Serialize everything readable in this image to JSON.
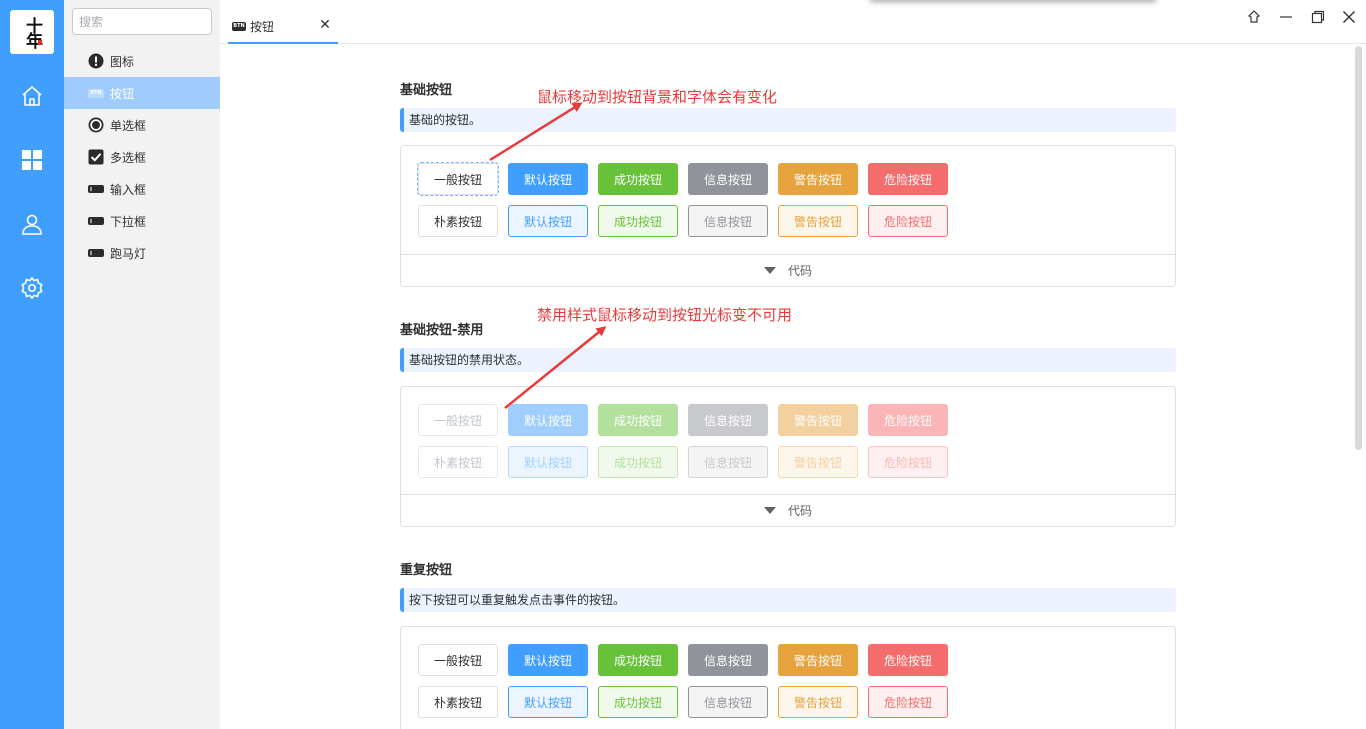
{
  "rail": {
    "logo_text": "十年",
    "items": [
      {
        "name": "home-icon"
      },
      {
        "name": "apps-grid-icon"
      },
      {
        "name": "user-icon"
      },
      {
        "name": "gear-icon"
      }
    ]
  },
  "sidebar": {
    "search_placeholder": "搜索",
    "items": [
      {
        "label": "图标",
        "icon": "alert-circle-icon"
      },
      {
        "label": "按钮",
        "icon": "btn-chip-icon",
        "active": true
      },
      {
        "label": "单选框",
        "icon": "radio-icon"
      },
      {
        "label": "多选框",
        "icon": "checkbox-icon"
      },
      {
        "label": "输入框",
        "icon": "input-icon"
      },
      {
        "label": "下拉框",
        "icon": "select-icon"
      },
      {
        "label": "跑马灯",
        "icon": "carousel-icon"
      }
    ]
  },
  "tabs": [
    {
      "label": "按钮",
      "chip": "BTN",
      "active": true
    }
  ],
  "colors": {
    "accent": "#409eff",
    "success": "#67c23a",
    "info": "#909399",
    "warning": "#e6a23c",
    "danger": "#f56c6c",
    "annotation": "#e83a3a"
  },
  "sections": [
    {
      "title": "基础按钮",
      "tip": "基础的按钮。",
      "annotation": "鼠标移动到按钮背景和字体会有变化",
      "row1": [
        "一般按钮",
        "默认按钮",
        "成功按钮",
        "信息按钮",
        "警告按钮",
        "危险按钮"
      ],
      "row2": [
        "朴素按钮",
        "默认按钮",
        "成功按钮",
        "信息按钮",
        "警告按钮",
        "危险按钮"
      ],
      "code_label": "代码"
    },
    {
      "title": "基础按钮-禁用",
      "tip": "基础按钮的禁用状态。",
      "annotation": "禁用样式鼠标移动到按钮光标变不可用",
      "row1": [
        "一般按钮",
        "默认按钮",
        "成功按钮",
        "信息按钮",
        "警告按钮",
        "危险按钮"
      ],
      "row2": [
        "朴素按钮",
        "默认按钮",
        "成功按钮",
        "信息按钮",
        "警告按钮",
        "危险按钮"
      ],
      "code_label": "代码"
    },
    {
      "title": "重复按钮",
      "tip": "按下按钮可以重复触发点击事件的按钮。",
      "row1": [
        "一般按钮",
        "默认按钮",
        "成功按钮",
        "信息按钮",
        "警告按钮",
        "危险按钮"
      ],
      "row2": [
        "朴素按钮",
        "默认按钮",
        "成功按钮",
        "信息按钮",
        "警告按钮",
        "危险按钮"
      ]
    }
  ]
}
